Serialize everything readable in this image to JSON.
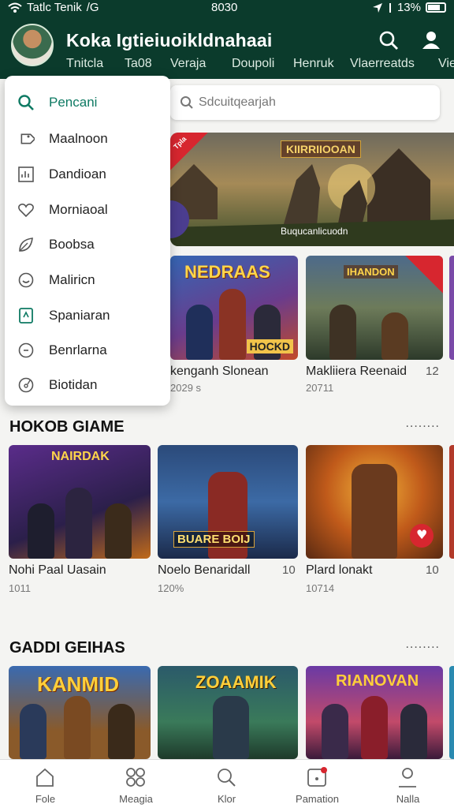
{
  "status_bar": {
    "left_text": "Tatlc Tenik",
    "network": "/G",
    "time": "8030",
    "battery": "13%"
  },
  "header": {
    "app_title": "Koka Igtieiuoikldnahaai",
    "tabs": [
      "Tnitcla",
      "Ta08",
      "Veraja",
      "Doupoli",
      "Henruk",
      "Vlaerreatds",
      "Vie"
    ]
  },
  "menu": {
    "items": [
      {
        "label": "Pencani",
        "icon": "search-icon",
        "active": true
      },
      {
        "label": "Maalnoon",
        "icon": "tag-icon"
      },
      {
        "label": "Dandioan",
        "icon": "chart-icon"
      },
      {
        "label": "Morniaoal",
        "icon": "heart-icon"
      },
      {
        "label": "Boobsa",
        "icon": "leaf-icon"
      },
      {
        "label": "Maliricn",
        "icon": "smile-icon"
      },
      {
        "label": "Spaniaran",
        "icon": "document-icon"
      },
      {
        "label": "Benrlarna",
        "icon": "clock-icon"
      },
      {
        "label": "Biotidan",
        "icon": "globe-icon"
      }
    ]
  },
  "search": {
    "placeholder": "Sdcuitqearjah"
  },
  "banner": {
    "title": "KIIRRIIOOAN",
    "caption": "Buqucanlicuodn",
    "ribbon": "Tpla"
  },
  "featured": [
    {
      "title": "kenganh Slonean",
      "sub": "2029 s",
      "number": "",
      "thumb_label": "NEDRAAS",
      "thumb_badge": "HOCKD"
    },
    {
      "title": "Makliiera Reenaid",
      "sub": "20711",
      "number": "12",
      "thumb_label": "IHANDON",
      "thumb_badge": ""
    }
  ],
  "sections": [
    {
      "title": "HOKOB GIAME",
      "more": "........",
      "cards": [
        {
          "title": "Nohi Paal Uasain",
          "sub": "1011",
          "number": "",
          "thumb_label": "NAIRDAK"
        },
        {
          "title": "Noelo Benaridall",
          "sub": "120%",
          "number": "10",
          "thumb_label": "BUARE BOIJ"
        },
        {
          "title": "Plard lonakt",
          "sub": "10714",
          "number": "10",
          "thumb_label": ""
        }
      ]
    },
    {
      "title": "GADDI GEIHAS",
      "more": "........",
      "cards": [
        {
          "title": "",
          "sub": "",
          "number": "",
          "thumb_label": "KANMID"
        },
        {
          "title": "",
          "sub": "",
          "number": "",
          "thumb_label": "ZOAAMIK"
        },
        {
          "title": "",
          "sub": "",
          "number": "",
          "thumb_label": "RIANOVAN"
        }
      ]
    }
  ],
  "bottom_nav": [
    {
      "label": "Fole",
      "icon": "home-icon"
    },
    {
      "label": "Meagia",
      "icon": "grid-icon"
    },
    {
      "label": "Klor",
      "icon": "search-icon"
    },
    {
      "label": "Pamation",
      "icon": "notification-icon"
    },
    {
      "label": "Nalla",
      "icon": "profile-icon"
    }
  ],
  "colors": {
    "header_bg": "#0b3b2c",
    "accent": "#0e7a63",
    "badge_red": "#d7262f"
  }
}
